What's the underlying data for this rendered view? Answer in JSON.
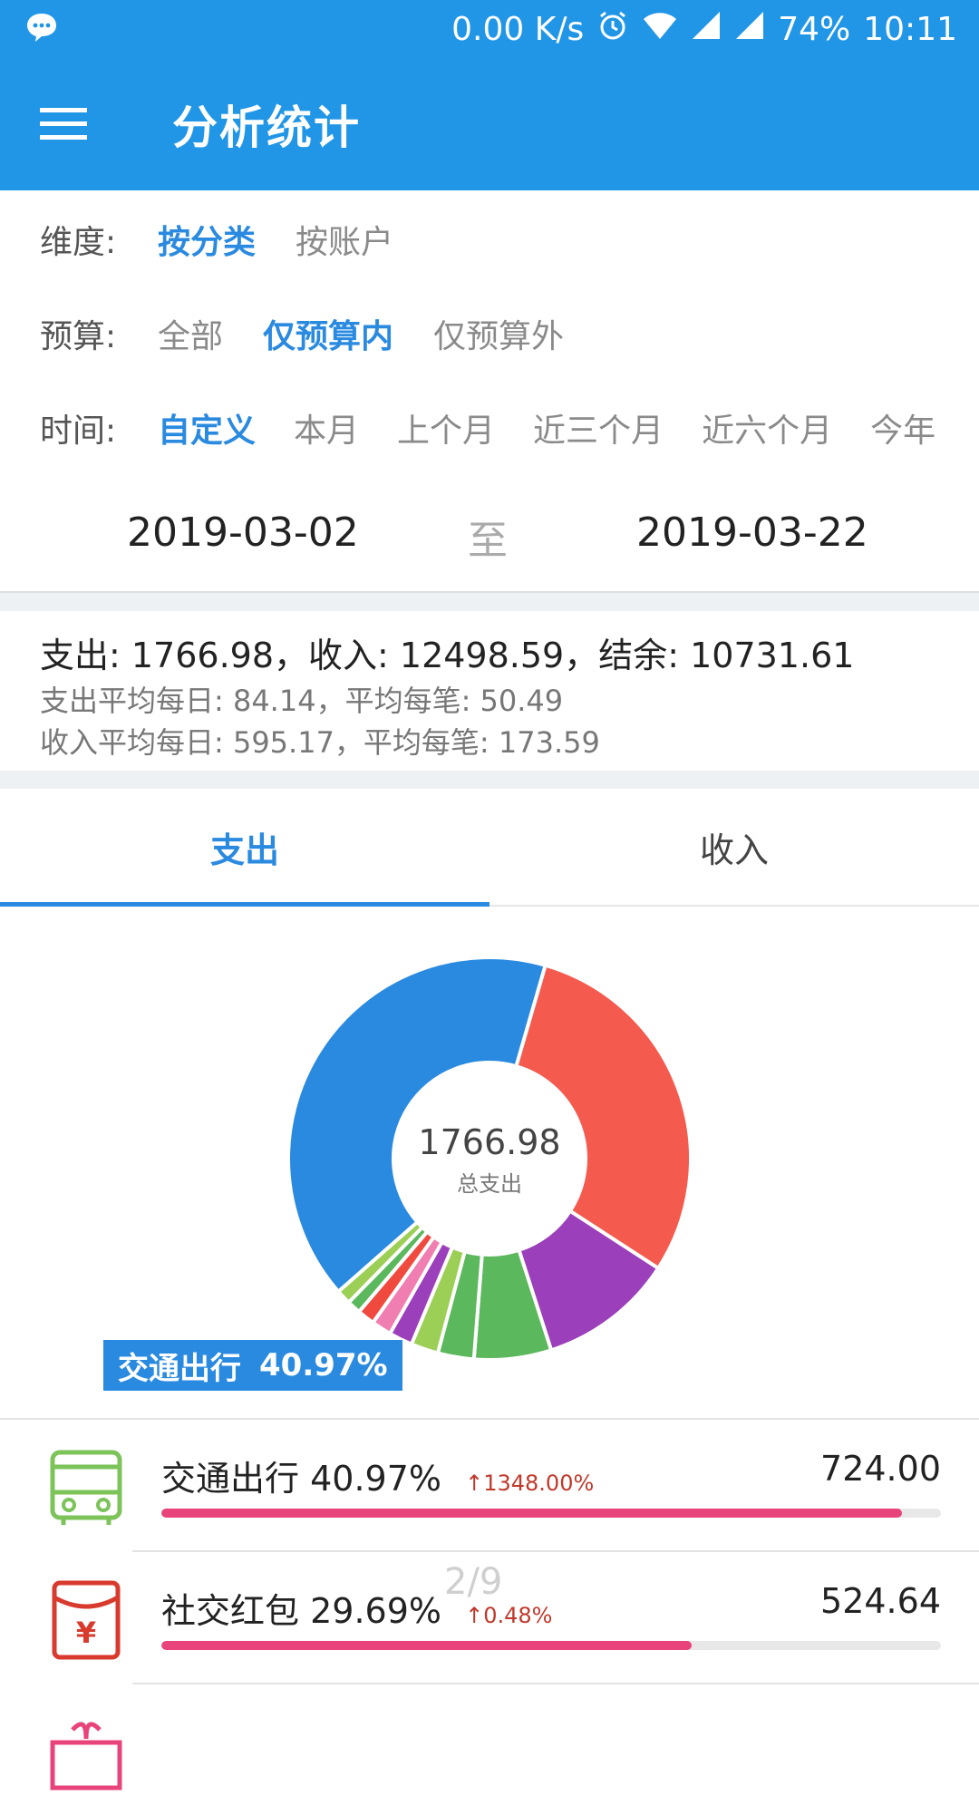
{
  "status_bar": {
    "speed": "0.00 K/s",
    "battery": "74%",
    "time": "10:11"
  },
  "app_bar": {
    "title": "分析统计"
  },
  "filters": {
    "dimension": {
      "label": "维度:",
      "options": [
        "按分类",
        "按账户"
      ],
      "selected": "按分类"
    },
    "budget": {
      "label": "预算:",
      "options": [
        "全部",
        "仅预算内",
        "仅预算外"
      ],
      "selected": "仅预算内"
    },
    "time": {
      "label": "时间:",
      "options": [
        "自定义",
        "本月",
        "上个月",
        "近三个月",
        "近六个月",
        "今年"
      ],
      "selected": "自定义"
    }
  },
  "date_range": {
    "start": "2019-03-02",
    "separator": "至",
    "end": "2019-03-22"
  },
  "summary": {
    "main": "支出: 1766.98，收入: 12498.59，结余: 10731.61",
    "expense_avg": "支出平均每日: 84.14，平均每笔: 50.49",
    "income_avg": "收入平均每日: 595.17，平均每笔: 173.59"
  },
  "tabs": [
    {
      "label": "支出",
      "active": true
    },
    {
      "label": "收入",
      "active": false
    }
  ],
  "chart_data": {
    "type": "pie",
    "center_value": "1766.98",
    "center_label": "总支出",
    "highlight": {
      "label": "交通出行",
      "percent": "40.97%"
    },
    "slices": [
      {
        "value": 40.97,
        "color": "#2a8ae0"
      },
      {
        "value": 29.69,
        "color": "#f45b4e"
      },
      {
        "value": 10.87,
        "color": "#9b3fba"
      },
      {
        "value": 6.2,
        "color": "#5cb85c"
      },
      {
        "value": 2.9,
        "color": "#5cb85c"
      },
      {
        "value": 2.2,
        "color": "#9ccf56"
      },
      {
        "value": 1.9,
        "color": "#9b3fba"
      },
      {
        "value": 1.6,
        "color": "#f07eb0"
      },
      {
        "value": 1.4,
        "color": "#f04a3f"
      },
      {
        "value": 1.1,
        "color": "#5cb85c"
      },
      {
        "value": 1.18,
        "color": "#9ccf56"
      }
    ]
  },
  "list": [
    {
      "icon": "bus-icon",
      "name": "交通出行",
      "percent": "40.97%",
      "change": "↑1348.00%",
      "amount": "724.00",
      "ratio": 0.95,
      "icon_color": "#7cc35a"
    },
    {
      "icon": "red-envelope-icon",
      "name": "社交红包",
      "percent": "29.69%",
      "change": "↑0.48%",
      "amount": "524.64",
      "ratio": 0.68,
      "icon_color": "#d83a2e"
    },
    {
      "icon": "gift-icon",
      "name": "",
      "percent": "",
      "change": "",
      "amount": "",
      "ratio": 0,
      "icon_color": "#e8437a"
    }
  ],
  "page_indicator": "2/9"
}
